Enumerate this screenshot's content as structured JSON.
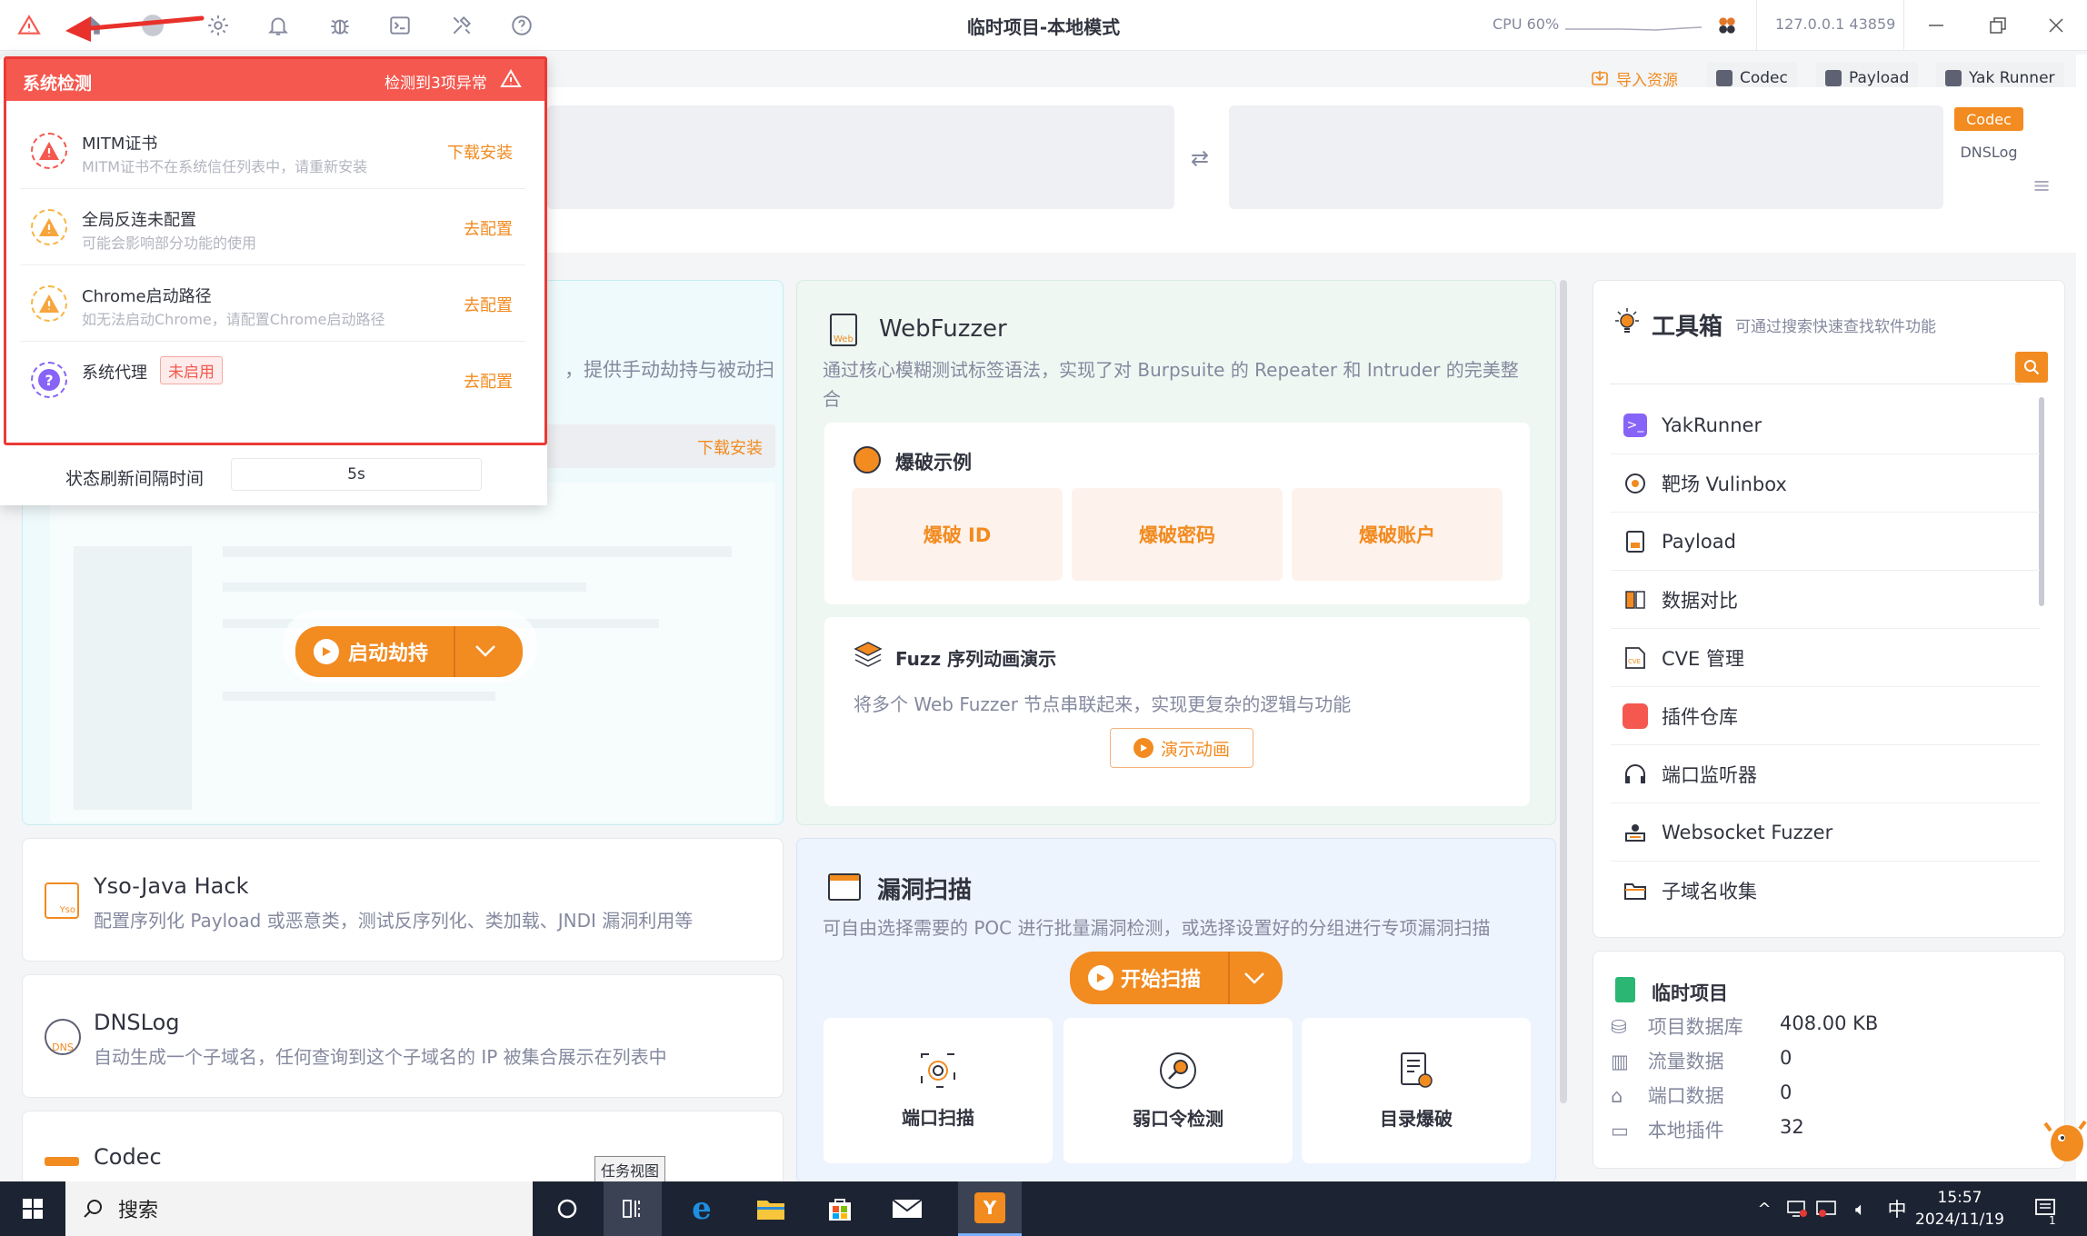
{
  "topbar": {
    "title": "临时项目-本地模式",
    "cpu": "CPU 60%",
    "ip": "127.0.0.1 43859"
  },
  "toolbar": {
    "import": "导入资源",
    "codec": "Codec",
    "payload": "Payload",
    "yakrunner": "Yak Runner"
  },
  "side_tabs": [
    "Codec",
    "DNSLog"
  ],
  "popup": {
    "header": "系统检测",
    "summary": "检测到3项异常",
    "items": [
      {
        "title": "MITM证书",
        "desc": "MITM证书不在系统信任列表中，请重新安装",
        "action": "下载安装"
      },
      {
        "title": "全局反连未配置",
        "desc": "可能会影响部分功能的使用",
        "action": "去配置"
      },
      {
        "title": "Chrome启动路径",
        "desc": "如无法启动Chrome，请配置Chrome启动路径",
        "action": "去配置"
      },
      {
        "title": "系统代理",
        "tag": "未启用",
        "action": "去配置"
      }
    ],
    "refresh_label": "状态刷新间隔时间",
    "refresh_value": "5s"
  },
  "mitm_card": {
    "desc_tail": "，提供手动劫持与被动扫",
    "download": "下载安装",
    "start_btn": "启动劫持"
  },
  "webfuzzer": {
    "title": "WebFuzzer",
    "desc": "通过核心模糊测试标签语法，实现了对 Burpsuite 的 Repeater 和 Intruder 的完美整合",
    "examples_title": "爆破示例",
    "examples": [
      "爆破 ID",
      "爆破密码",
      "爆破账户"
    ],
    "seq_title": "Fuzz 序列动画演示",
    "seq_desc": "将多个 Web Fuzzer 节点串联起来，实现更复杂的逻辑与功能",
    "seq_btn": "演示动画"
  },
  "vulscan": {
    "title": "漏洞扫描",
    "desc": "可自由选择需要的 POC 进行批量漏洞检测，或选择设置好的分组进行专项漏洞扫描",
    "start_btn": "开始扫描",
    "modules": [
      "端口扫描",
      "弱口令检测",
      "目录爆破"
    ]
  },
  "yso": {
    "title": "Yso-Java Hack",
    "desc": "配置序列化 Payload 或恶意类，测试反序列化、类加载、JNDI 漏洞利用等",
    "icon_text": "Yso"
  },
  "dnslog": {
    "title": "DNSLog",
    "desc": "自动生成一个子域名，任何查询到这个子域名的 IP 被集合展示在列表中",
    "icon_text": "DNS"
  },
  "codec": {
    "title": "Codec"
  },
  "toolbox": {
    "title": "工具箱",
    "subtitle": "可通过搜索快速查找软件功能",
    "items": [
      "YakRunner",
      "靶场 Vulinbox",
      "Payload",
      "数据对比",
      "CVE 管理",
      "插件仓库",
      "端口监听器",
      "Websocket Fuzzer",
      "子域名收集"
    ]
  },
  "project": {
    "title": "临时项目",
    "stats": [
      {
        "label": "项目数据库",
        "value": "408.00 KB"
      },
      {
        "label": "流量数据",
        "value": "0"
      },
      {
        "label": "端口数据",
        "value": "0"
      },
      {
        "label": "本地插件",
        "value": "32"
      }
    ]
  },
  "tooltip": "任务视图",
  "taskbar": {
    "search": "搜索",
    "ime": "中",
    "time": "15:57",
    "date": "2024/11/19",
    "notif_count": "1"
  },
  "colors": {
    "accent": "#f28b20",
    "alert_red": "#f4584f",
    "frame_red": "#ea3a35",
    "purple": "#8863f7"
  }
}
